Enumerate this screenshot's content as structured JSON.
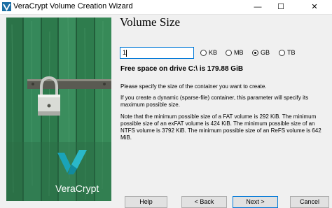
{
  "window": {
    "title": "VeraCrypt Volume Creation Wizard",
    "controls": {
      "minimize": "—",
      "maximize": "☐",
      "close": "✕"
    }
  },
  "side_image": {
    "brand_text": "VeraCrypt"
  },
  "page": {
    "heading": "Volume Size",
    "size_value": "1",
    "units": [
      {
        "label": "KB",
        "selected": false
      },
      {
        "label": "MB",
        "selected": false
      },
      {
        "label": "GB",
        "selected": true
      },
      {
        "label": "TB",
        "selected": false
      }
    ],
    "free_space": "Free space on drive C:\\ is 179.88 GiB",
    "para1": "Please specify the size of the container you want to create.",
    "para2": "If you create a dynamic (sparse-file) container, this parameter will specify its maximum possible size.",
    "para3": "Note that the minimum possible size of a FAT volume is 292 KiB. The minimum possible size of an exFAT volume is 424 KiB. The minimum possible size of an NTFS volume is 3792 KiB. The minimum possible size of an ReFS volume is 642 MiB."
  },
  "buttons": {
    "help": "Help",
    "back": "< Back",
    "next": "Next >",
    "cancel": "Cancel"
  },
  "colors": {
    "accent": "#0078d7",
    "background": "#f0f0f0",
    "door_green": "#2f7d4f"
  }
}
